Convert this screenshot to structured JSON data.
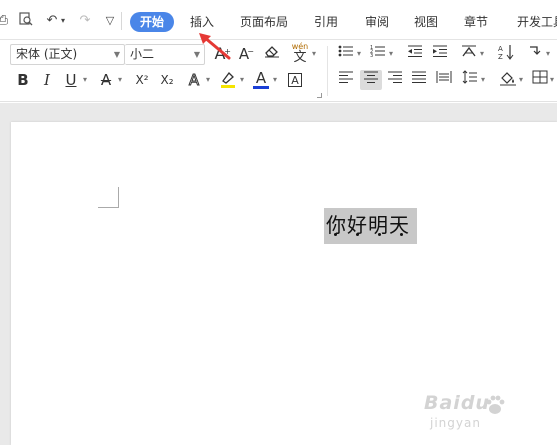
{
  "toolbar": {
    "tabs": [
      {
        "label": "开始",
        "active": true
      },
      {
        "label": "插入",
        "active": false
      },
      {
        "label": "页面布局",
        "active": false
      },
      {
        "label": "引用",
        "active": false
      },
      {
        "label": "审阅",
        "active": false
      },
      {
        "label": "视图",
        "active": false
      },
      {
        "label": "章节",
        "active": false
      },
      {
        "label": "开发工具",
        "active": false
      }
    ],
    "quick_access": [
      "print-preview-icon",
      "find-icon",
      "undo-icon",
      "redo-icon",
      "customize-icon"
    ]
  },
  "ribbon": {
    "font_name": "宋体 (正文)",
    "font_size": "小二",
    "bold_glyph": "B",
    "italic_glyph": "I",
    "underline_glyph": "U",
    "strike_glyph": "A",
    "superscript_glyph": "X²",
    "subscript_glyph": "X₂",
    "font_color_glyph": "A",
    "clear_glyph": "A",
    "phonetic_glyph": "wén",
    "phonetic_char": "文",
    "char_border_glyph": "A",
    "grow_glyph": "A",
    "shrink_glyph": "A",
    "char_shading_glyph": "A"
  },
  "document": {
    "selected_text": "你好明天"
  },
  "colors": {
    "accent": "#4a86e8",
    "font_color_bar": "#1a3fd6",
    "highlight_bar": "#f5e400",
    "annotation_arrow": "#e53935",
    "selection": "#c8c8c8"
  },
  "watermark": {
    "brand": "Baidu",
    "sub": "jingyan"
  }
}
